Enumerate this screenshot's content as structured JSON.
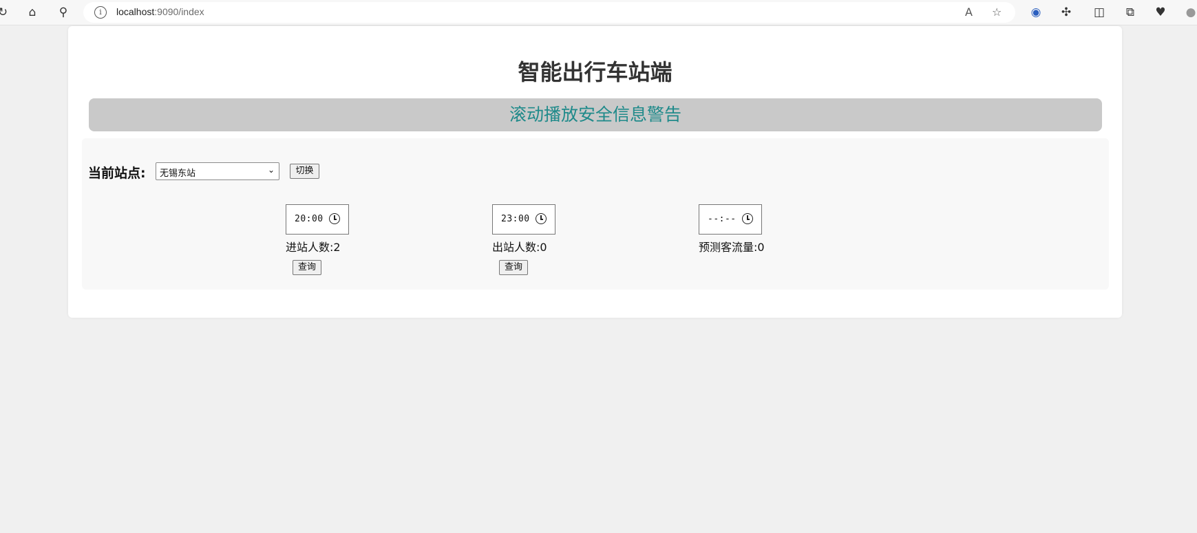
{
  "browser": {
    "url_host": "localhost",
    "url_rest": ":9090/index"
  },
  "page": {
    "title": "智能出行车站端",
    "banner": "滚动播放安全信息警告",
    "banner_color": "#1f8a8a",
    "station_label": "当前站点:",
    "station_selected": "无锡东站",
    "switch_button": "切换"
  },
  "queries": [
    {
      "time": "20:00",
      "result_label": "进站人数:",
      "result_value": "2",
      "query_button": "查询"
    },
    {
      "time": "23:00",
      "result_label": "出站人数:",
      "result_value": "0",
      "query_button": "查询"
    },
    {
      "time": "--:--",
      "result_label": "预测客流量:",
      "result_value": "0"
    }
  ]
}
